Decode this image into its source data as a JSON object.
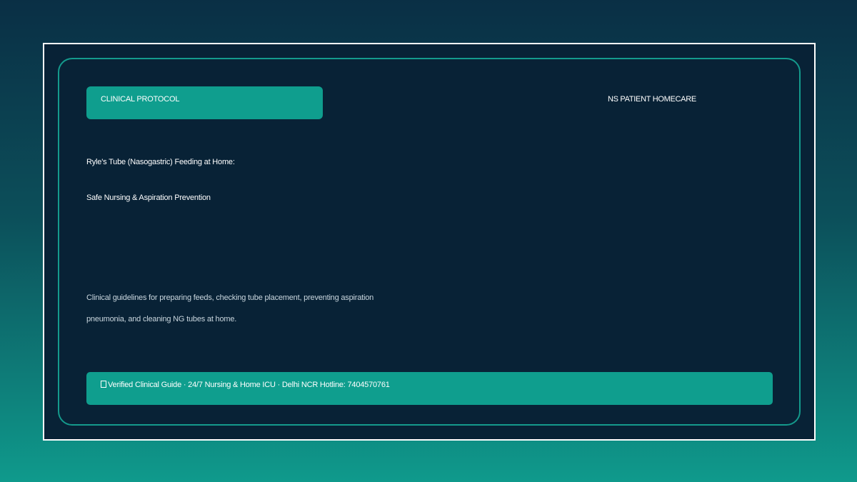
{
  "header": {
    "badge_label": "CLINICAL PROTOCOL",
    "brand": "NS PATIENT HOMECARE"
  },
  "title": {
    "line1": "Ryle's Tube (Nasogastric) Feeding at Home:",
    "line2": "Safe Nursing & Aspiration Prevention"
  },
  "description": {
    "line1": "Clinical guidelines for preparing feeds, checking tube placement, preventing aspiration",
    "line2": "pneumonia, and cleaning NG tubes at home."
  },
  "footer": {
    "icon": "check-box-icon",
    "text": "Verified Clinical Guide · 24/7 Nursing & Home ICU · Delhi NCR Hotline: 7404570761"
  },
  "colors": {
    "accent": "#0f9e8e",
    "card_background": "#082236",
    "border": "#149a8c"
  }
}
